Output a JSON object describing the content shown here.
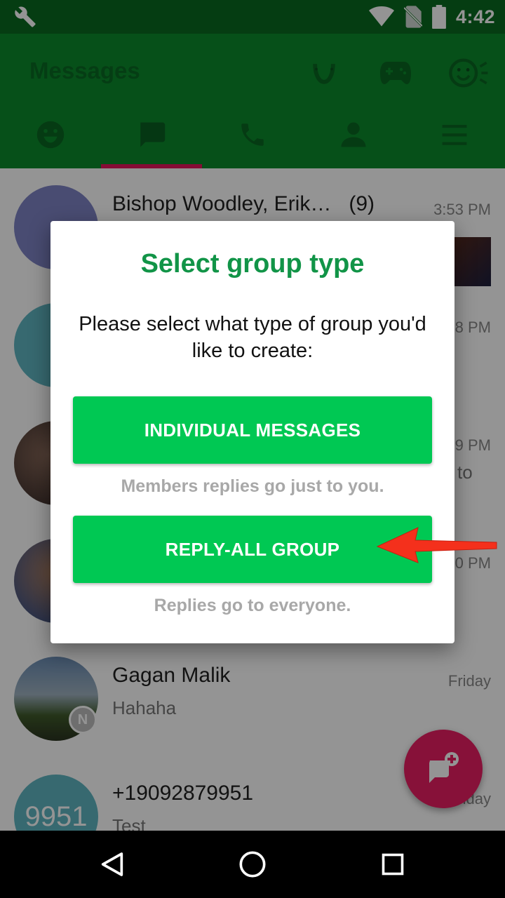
{
  "status_bar": {
    "time": "4:42",
    "icons": [
      "wrench-icon",
      "wifi-icon",
      "no-sim-icon",
      "battery-icon"
    ]
  },
  "app_bar": {
    "title": "Messages",
    "actions": [
      "horseshoe-icon",
      "gamepad-icon",
      "emoji-icon"
    ],
    "tabs": [
      {
        "name": "tab-emoji",
        "icon": "smiley-icon",
        "active": false
      },
      {
        "name": "tab-messages",
        "icon": "chat-icon",
        "active": true
      },
      {
        "name": "tab-calls",
        "icon": "phone-icon",
        "active": false
      },
      {
        "name": "tab-contacts",
        "icon": "person-icon",
        "active": false
      },
      {
        "name": "tab-menu",
        "icon": "menu-icon",
        "active": false
      }
    ]
  },
  "conversations": [
    {
      "name": "Bishop Woodley, Erik…",
      "count": "(9)",
      "time": "3:53 PM",
      "snippet": ""
    },
    {
      "name": "",
      "time": "8 PM",
      "snippet": ""
    },
    {
      "name": "",
      "time": "9 PM",
      "snippet": "to"
    },
    {
      "name": "",
      "time": "0 PM",
      "snippet": ""
    },
    {
      "name": "Gagan Malik",
      "time": "Friday",
      "snippet": "Hahaha",
      "badge": "N"
    },
    {
      "name": "+19092879951",
      "time": "iday",
      "snippet": "Test",
      "avatar_text": "9951"
    }
  ],
  "dialog": {
    "title": "Select group type",
    "message": "Please select what type of group you'd like to create:",
    "option1_label": "INDIVIDUAL MESSAGES",
    "option1_hint": "Members replies go just to you.",
    "option2_label": "REPLY-ALL GROUP",
    "option2_hint": "Replies go to everyone."
  },
  "colors": {
    "status_bar": "#0a6a1f",
    "app_bar": "#0c8a2c",
    "accent": "#e91e63",
    "button": "#00c853",
    "dialog_title": "#119447",
    "arrow": "#f4301c"
  }
}
